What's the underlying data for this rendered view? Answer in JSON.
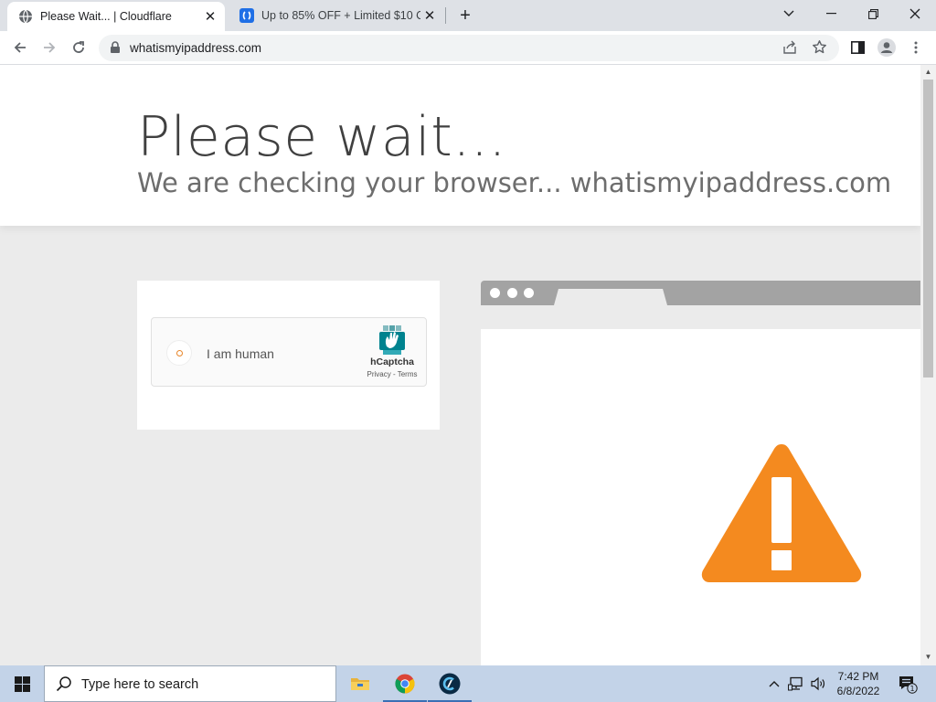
{
  "browser": {
    "tabs": [
      {
        "title": "Please Wait... | Cloudflare",
        "active": true
      },
      {
        "title": "Up to 85% OFF + Limited $10 Co",
        "active": false
      }
    ],
    "url": "whatismyipaddress.com"
  },
  "page": {
    "heading": "Please wait...",
    "subheading": "We are checking your browser... whatismyipaddress.com",
    "captcha": {
      "label": "I am human",
      "brand": "hCaptcha",
      "links": "Privacy - Terms"
    }
  },
  "taskbar": {
    "search_placeholder": "Type here to search",
    "time": "7:42 PM",
    "date": "6/8/2022",
    "notification_count": "1"
  },
  "colors": {
    "warning_orange": "#f48a1f",
    "captcha_teal": "#00838f"
  }
}
